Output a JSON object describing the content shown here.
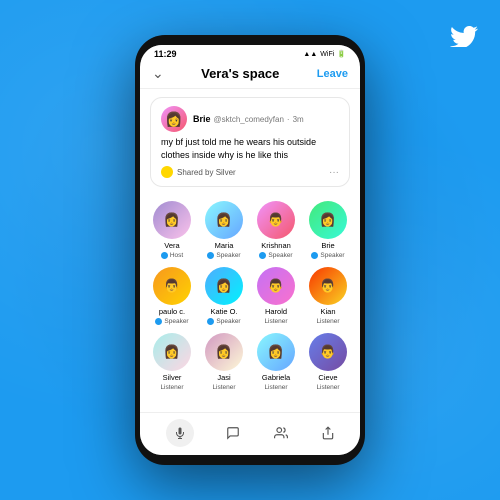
{
  "background": {
    "color": "#1d9bf0"
  },
  "twitter_logo": "🐦",
  "status_bar": {
    "time": "11:29",
    "icons": "▲▲ WiFi 🔋"
  },
  "header": {
    "chevron": "⌄",
    "title": "Vera's space",
    "leave_label": "Leave"
  },
  "tweet": {
    "author_name": "Brie",
    "author_handle": "@sktch_comedyfan",
    "time": "3m",
    "text": "my bf just told me he wears his outside clothes inside why is he like this",
    "shared_by": "Shared by Silver"
  },
  "participants": [
    {
      "name": "Vera",
      "role": "Host",
      "has_badge": true,
      "row": 1
    },
    {
      "name": "Maria",
      "role": "Speaker",
      "has_badge": true,
      "row": 1
    },
    {
      "name": "Krishnan",
      "role": "Speaker",
      "has_badge": true,
      "row": 1
    },
    {
      "name": "Brie",
      "role": "Speaker",
      "has_badge": true,
      "row": 1
    },
    {
      "name": "paulo c.",
      "role": "Speaker",
      "has_badge": true,
      "row": 2
    },
    {
      "name": "Katie O.",
      "role": "Speaker",
      "has_badge": true,
      "row": 2
    },
    {
      "name": "Harold",
      "role": "Listener",
      "has_badge": false,
      "row": 2
    },
    {
      "name": "Kian",
      "role": "Listener",
      "has_badge": false,
      "row": 2
    },
    {
      "name": "Silver",
      "role": "Listener",
      "has_badge": false,
      "row": 3
    },
    {
      "name": "Jasi",
      "role": "Listener",
      "has_badge": false,
      "row": 3
    },
    {
      "name": "Gabriela",
      "role": "Listener",
      "has_badge": false,
      "row": 3
    },
    {
      "name": "Cieve",
      "role": "Listener",
      "has_badge": false,
      "row": 3
    }
  ],
  "bottom_bar": {
    "mute_icon": "🎤",
    "chat_icon": "💬",
    "people_icon": "👥",
    "share_icon": "↑"
  }
}
